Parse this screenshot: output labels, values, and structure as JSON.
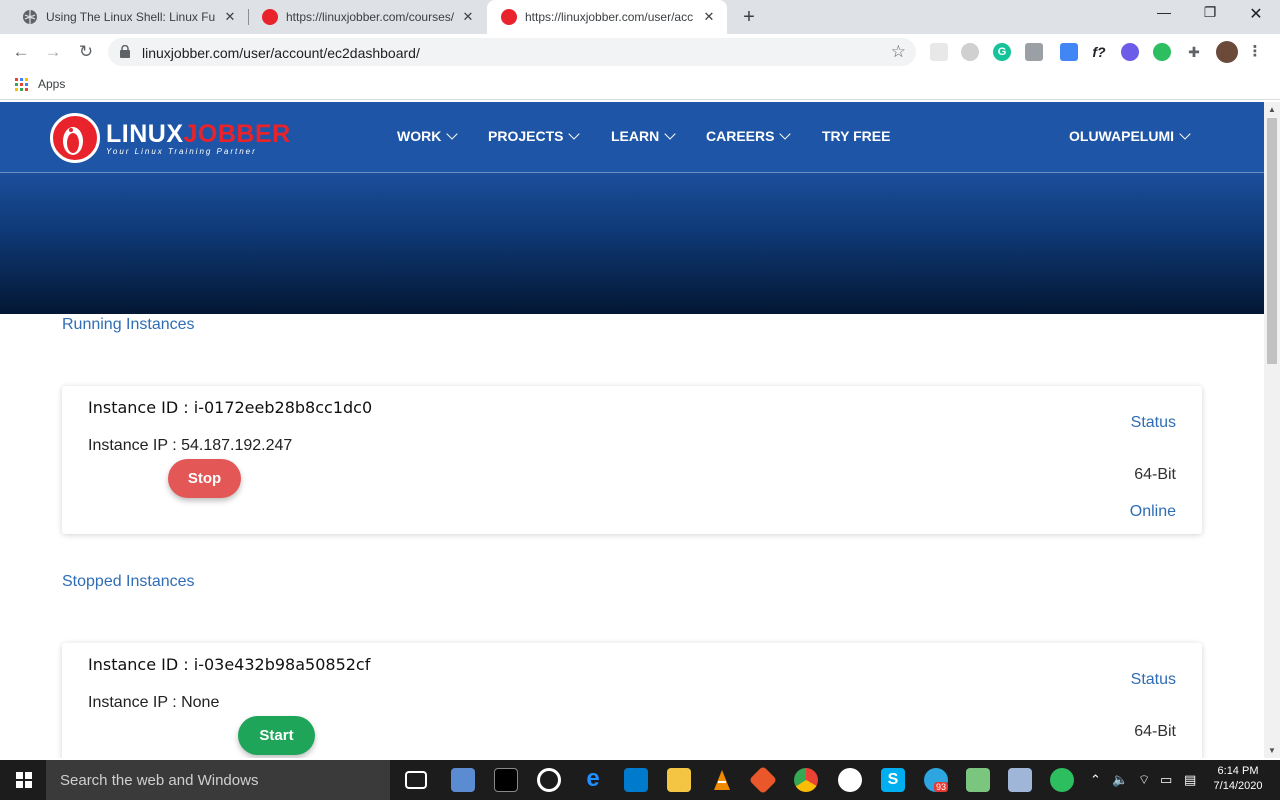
{
  "browser": {
    "tabs": [
      {
        "title": "Using The Linux Shell: Linux Func",
        "active": false
      },
      {
        "title": "https://linuxjobber.com/courses/",
        "active": false
      },
      {
        "title": "https://linuxjobber.com/user/acc",
        "active": true
      }
    ],
    "url": "linuxjobber.com/user/account/ec2dashboard/",
    "bookmarks_apps": "Apps"
  },
  "site": {
    "logo_word_1": "LINUX",
    "logo_word_2": "JOBBER",
    "logo_tagline": "Your Linux Training Partner",
    "menu": [
      "WORK",
      "PROJECTS",
      "LEARN",
      "CAREERS",
      "TRY FREE"
    ],
    "user": "OLUWAPELUMI"
  },
  "running": {
    "title": "Running Instances",
    "instance": {
      "id": "Instance ID : i-0172eeb28b8cc1dc0",
      "ip": "Instance IP : 54.187.192.247",
      "button": "Stop",
      "status_label": "Status",
      "arch": "64-Bit",
      "state": "Online"
    }
  },
  "stopped": {
    "title": "Stopped Instances",
    "instance": {
      "id": "Instance ID : i-03e432b98a50852cf",
      "ip": "Instance IP : None",
      "button": "Start",
      "status_label": "Status",
      "arch": "64-Bit"
    }
  },
  "taskbar": {
    "search_placeholder": "Search the web and Windows",
    "time": "6:14 PM",
    "date": "7/14/2020",
    "telegram_badge": "93"
  },
  "colors": {
    "brand_blue": "#1e55a6",
    "brand_red": "#e8232c",
    "link_blue": "#2f6db5",
    "stop_red": "#e35757",
    "start_green": "#1fa55a"
  }
}
